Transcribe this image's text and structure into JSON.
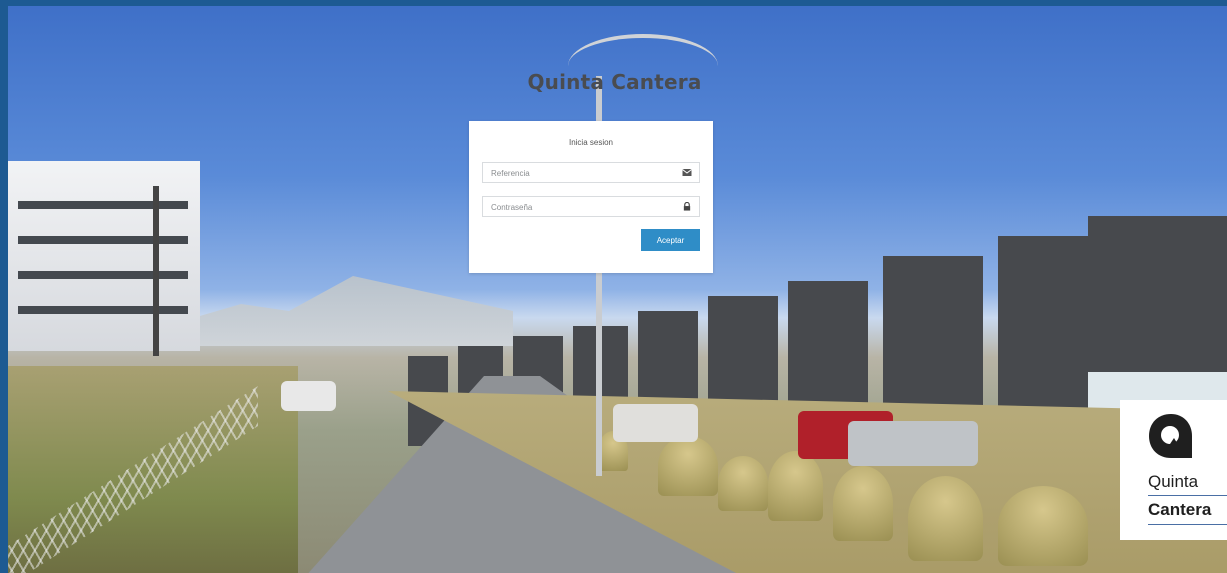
{
  "brand": {
    "title": "Quinta Cantera"
  },
  "login": {
    "heading": "Inicia sesion",
    "reference_placeholder": "Referencia",
    "reference_value": "",
    "reference_icon": "envelope-icon",
    "password_placeholder": "Contraseña",
    "password_value": "",
    "password_icon": "lock-icon",
    "accept_label": "Aceptar"
  },
  "logo": {
    "line1": "Quinta",
    "line2": "Cantera"
  },
  "colors": {
    "accent_button": "#2f8dc7",
    "title_text": "#4a4c50",
    "frame_border": "#1d5a92"
  }
}
